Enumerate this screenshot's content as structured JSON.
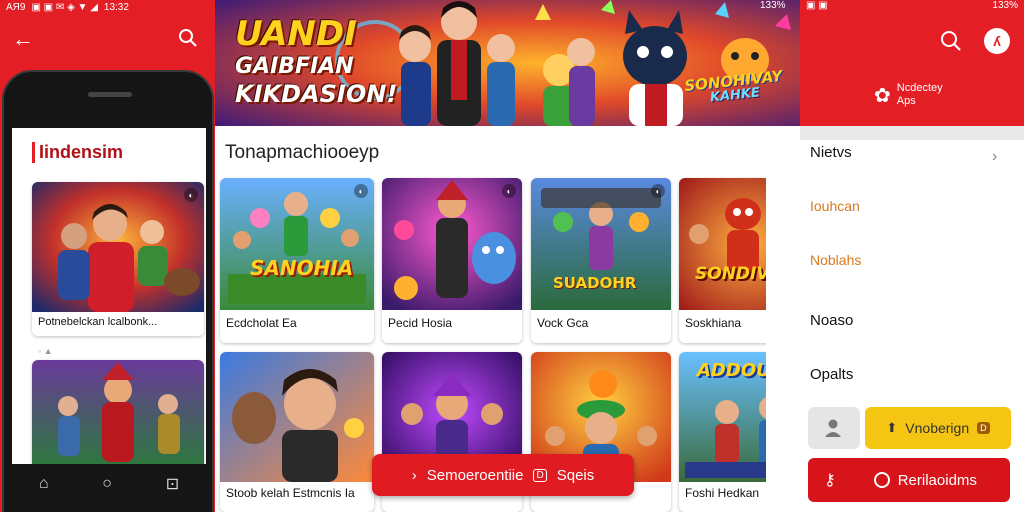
{
  "left": {
    "status": {
      "time": "AЯ9",
      "clock": "13:32"
    },
    "title": "Iindensim",
    "cards": [
      {
        "label": "Potnebelckan lcalbonk...",
        "badge": "♻"
      },
      {
        "label": "",
        "badge": ""
      }
    ]
  },
  "banner": {
    "line1": "UANDI",
    "line2": "GAIBFIAN",
    "line3": "KIKDASION!",
    "logo_line1": "SONOHIVAY",
    "logo_line2": "KAHKE",
    "status_battery": "133%"
  },
  "center": {
    "section_title": "Tonapmachiooeyp",
    "games_row1": [
      {
        "label": "Ecdcholat Ea",
        "art": "SANOHIA"
      },
      {
        "label": "Pecid Hosia",
        "art": ""
      },
      {
        "label": "Vock Gca",
        "art": "SUADOHR"
      },
      {
        "label": "Soskhiana",
        "art": "SONDIVIA"
      }
    ],
    "games_row2": [
      {
        "label": "Stoob kelah Estmcnis Ia"
      },
      {
        "label": ""
      },
      {
        "label": ""
      },
      {
        "label": "Foshi Hedkan",
        "art": "ADDOURD"
      }
    ],
    "promo_button": {
      "left": "Semoeroentiie",
      "right": "Sqeis"
    }
  },
  "right": {
    "status": {
      "battery": "133%"
    },
    "brand": "Ncdectey Aps",
    "menu": [
      {
        "label": "Nietvs"
      },
      {
        "label": "Iouhcan"
      },
      {
        "label": "Noblahs"
      },
      {
        "label": "Noaso"
      },
      {
        "label": "Opalts"
      }
    ],
    "yellow_button": "Vnoberign",
    "red_button": "Rerilaoidms"
  },
  "colors": {
    "brand_red": "#e31e24",
    "accent_yellow": "#f5c514",
    "menu_accent": "#d77a1e"
  }
}
